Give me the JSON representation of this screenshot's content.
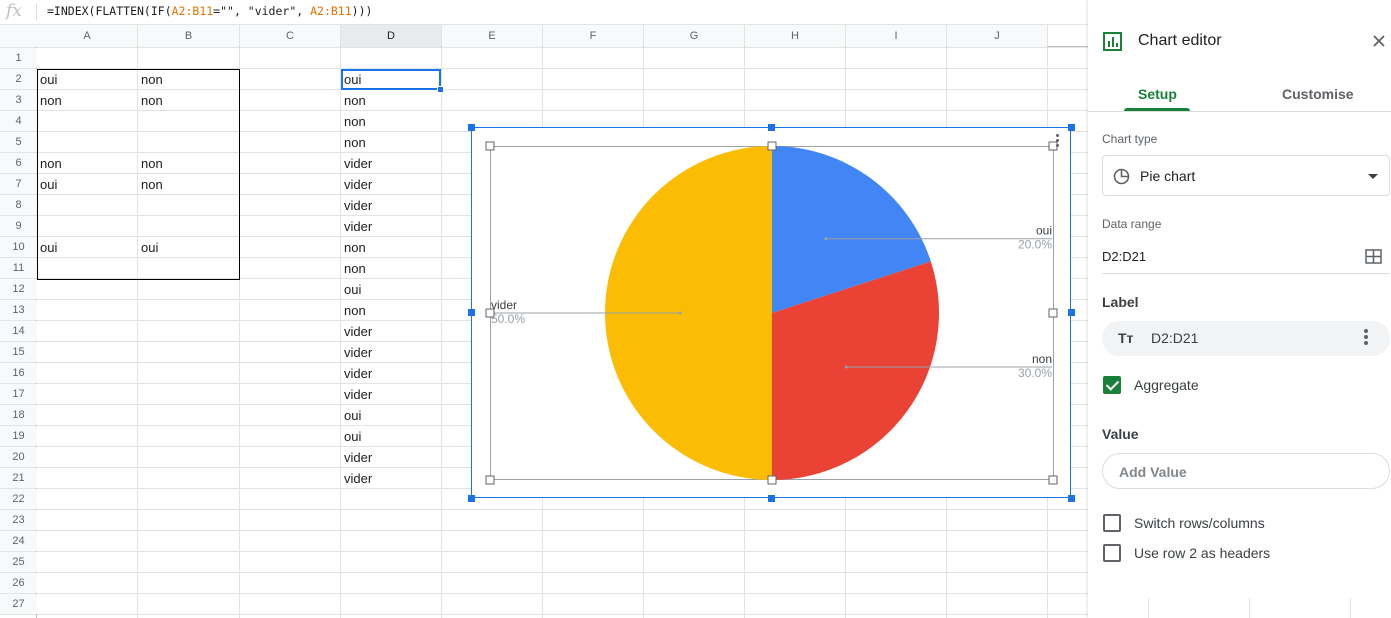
{
  "formula_bar": {
    "fx": "fx",
    "formula_parts": [
      "=INDEX(FLATTEN(IF(",
      "A2:B11",
      "=\"\", \"vider\", ",
      "A2:B11",
      ")))"
    ]
  },
  "columns": [
    "A",
    "B",
    "C",
    "D",
    "E",
    "F",
    "G",
    "H",
    "I",
    "J"
  ],
  "selected_column": "D",
  "rows": [
    "1",
    "2",
    "3",
    "4",
    "5",
    "6",
    "7",
    "8",
    "9",
    "10",
    "11",
    "12",
    "13",
    "14",
    "15",
    "16",
    "17",
    "18",
    "19",
    "20",
    "21",
    "22",
    "23",
    "24",
    "25",
    "26",
    "27"
  ],
  "col_a": [
    "",
    "oui",
    "non",
    "",
    "",
    "non",
    "oui",
    "",
    "",
    "oui",
    ""
  ],
  "col_b": [
    "",
    "non",
    "non",
    "",
    "",
    "non",
    "non",
    "",
    "",
    "oui",
    ""
  ],
  "col_d": [
    "",
    "oui",
    "non",
    "non",
    "non",
    "vider",
    "vider",
    "vider",
    "vider",
    "non",
    "non",
    "oui",
    "non",
    "vider",
    "vider",
    "vider",
    "vider",
    "oui",
    "oui",
    "vider",
    "vider"
  ],
  "chart_data": {
    "type": "pie",
    "categories": [
      "oui",
      "non",
      "vider"
    ],
    "values": [
      20.0,
      30.0,
      50.0
    ],
    "labels": [
      "oui",
      "non",
      "vider"
    ],
    "percent_labels": [
      "20.0%",
      "30.0%",
      "50.0%"
    ],
    "colors": [
      "#4285f4",
      "#ea4335",
      "#fbbc04"
    ],
    "legend": "none",
    "label_style": "callouts"
  },
  "panel": {
    "title": "Chart editor",
    "icon": "chart-icon",
    "close_icon": "close-icon",
    "tabs": [
      "Setup",
      "Customise"
    ],
    "active_tab": "Setup",
    "chart_type_label": "Chart type",
    "chart_type_value": "Pie chart",
    "data_range_label": "Data range",
    "data_range_value": "D2:D21",
    "label_heading": "Label",
    "label_chip_icon": "Tт",
    "label_value": "D2:D21",
    "aggregate_label": "Aggregate",
    "aggregate_checked": true,
    "value_heading": "Value",
    "add_value_placeholder": "Add Value",
    "switch_label": "Switch rows/columns",
    "switch_checked": false,
    "headers_label": "Use row 2 as headers",
    "headers_checked": false
  },
  "colors": {
    "accent_green": "#188038",
    "selection_blue": "#1a73e8"
  }
}
